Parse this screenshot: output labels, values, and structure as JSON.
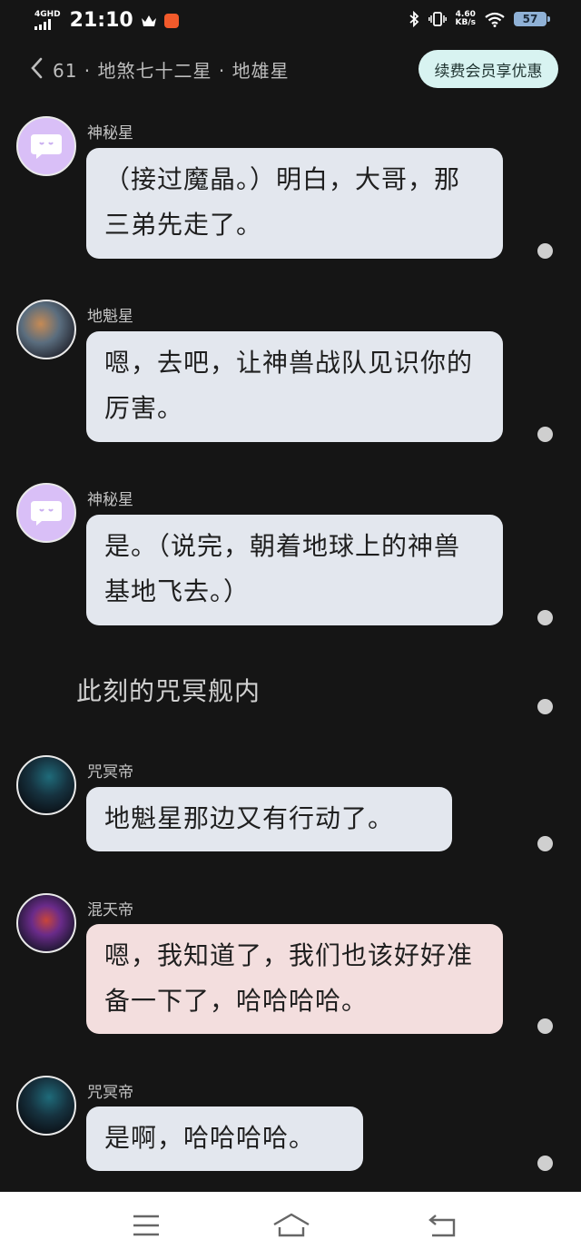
{
  "status": {
    "network": "4GHD",
    "time": "21:10",
    "speed_value": "4.60",
    "speed_unit": "KB/s",
    "battery": "57"
  },
  "header": {
    "back_count": "61",
    "title": "61 · 地煞七十二星 · 地雄星",
    "vip_button": "续费会员享优惠"
  },
  "messages": [
    {
      "name": "神秘星",
      "text": "（接过魔晶。）明白，大哥，那三弟先走了。",
      "avatar": "ghost-avatar"
    },
    {
      "name": "地魁星",
      "text": "嗯，去吧，让神兽战队见识你的厉害。",
      "avatar": "character-avatar"
    },
    {
      "name": "神秘星",
      "text": "是。（说完，朝着地球上的神兽基地飞去。）",
      "avatar": "ghost-avatar"
    },
    {
      "narration": "此刻的咒冥舰内"
    },
    {
      "name": "咒冥帝",
      "text": "地魁星那边又有行动了。",
      "avatar": "dark-avatar"
    },
    {
      "name": "混天帝",
      "text": "嗯，我知道了，我们也该好好准备一下了，哈哈哈哈。",
      "avatar": "demon-avatar"
    },
    {
      "name": "咒冥帝",
      "text": "是啊，哈哈哈哈。",
      "avatar": "dark-avatar"
    }
  ],
  "colors": {
    "background": "#151515",
    "bubble_default": "#e3e7ee",
    "bubble_pink": "#f3dede",
    "vip_button": "#d8f3f1"
  }
}
